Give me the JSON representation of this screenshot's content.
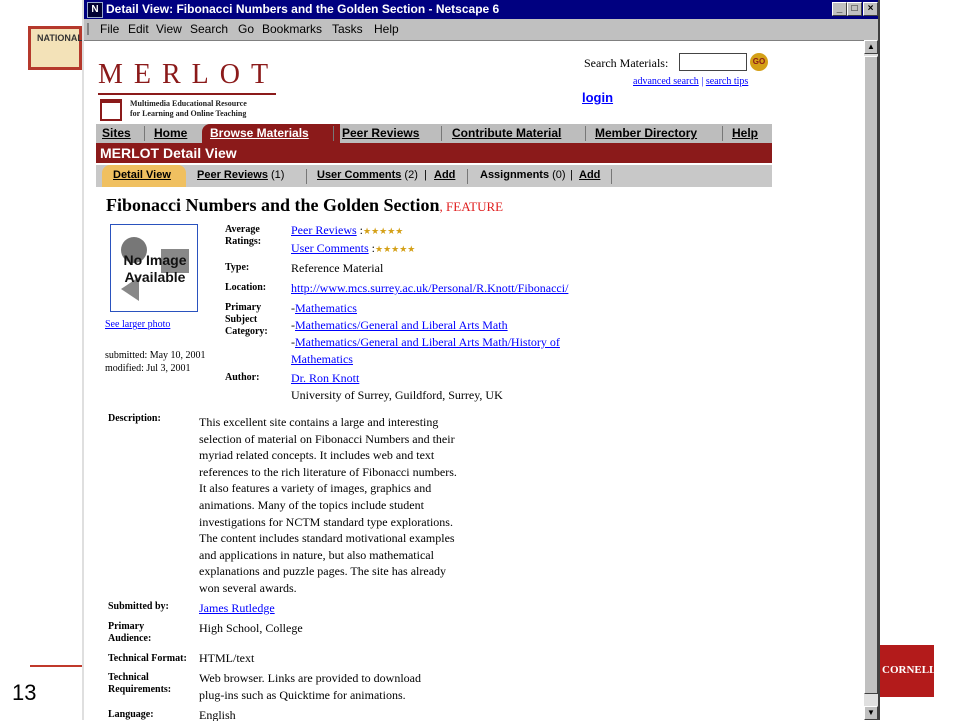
{
  "slide": {
    "logo_text": "NATIONAL",
    "slide_number": "13",
    "cornell_logo": "CORNELL"
  },
  "window": {
    "title": "Detail View: Fibonacci Numbers and the Golden Section - Netscape 6",
    "app_icon": "N",
    "menu": [
      "File",
      "Edit",
      "View",
      "Search",
      "Go",
      "Bookmarks",
      "Tasks",
      "Help"
    ]
  },
  "header": {
    "logo_word": "MERLOT",
    "logo_tagline_1": "Multimedia Educational Resource",
    "logo_tagline_2": "for Learning and Online Teaching",
    "search_label": "Search Materials:",
    "search_value": "",
    "go_label": "GO",
    "advanced_search": "advanced search",
    "separator": "|",
    "search_tips": "search tips",
    "login": "login"
  },
  "nav": {
    "items": [
      "Sites",
      "Home",
      "Browse Materials",
      "Peer Reviews",
      "Contribute Material",
      "Member Directory",
      "Help"
    ],
    "active": "Browse Materials"
  },
  "detail_bar": "MERLOT Detail View",
  "subtabs": {
    "detail_view": "Detail View",
    "peer_reviews": "Peer Reviews",
    "peer_reviews_count": "(1)",
    "user_comments": "User Comments",
    "user_comments_count": "(2)",
    "add1": "Add",
    "assignments": "Assignments",
    "assignments_count": "(0)",
    "add2": "Add",
    "pipe": "|"
  },
  "material": {
    "title": "Fibonacci Numbers and the Golden Section",
    "feature": ", FEATURE",
    "no_image_1": "No Image",
    "no_image_2": "Available",
    "see_larger": "See larger photo",
    "submitted": "submitted: May 10, 2001",
    "modified": "modified: Jul 3, 2001",
    "labels": {
      "avg_ratings_1": "Average",
      "avg_ratings_2": "Ratings:",
      "type": "Type:",
      "location": "Location:",
      "primary_1": "Primary",
      "primary_2": "Subject",
      "primary_3": "Category:",
      "author": "Author:",
      "description": "Description:",
      "submitted_by": "Submitted by:",
      "audience_1": "Primary",
      "audience_2": "Audience:",
      "tech_format": "Technical Format:",
      "tech_req_1": "Technical",
      "tech_req_2": "Requirements:",
      "language": "Language:"
    },
    "peer_reviews_link": "Peer Reviews",
    "user_comments_link": "User Comments",
    "rating_stars": "★★★★★",
    "colon": ":",
    "type": "Reference Material",
    "location": "http://www.mcs.surrey.ac.uk/Personal/R.Knott/Fibonacci/",
    "category_dash": "-",
    "category_1": "Mathematics",
    "category_2": "Mathematics/General and Liberal Arts Math",
    "category_3a": "Mathematics/General and Liberal Arts Math/History of",
    "category_3b": "Mathematics",
    "author_name": "Dr. Ron Knott",
    "author_affil": "University of Surrey, Guildford, Surrey, UK",
    "description_lines": [
      "This excellent site contains a large and interesting",
      "selection of material on Fibonacci Numbers and their",
      "myriad related concepts. It includes web and text",
      "references to the rich literature of Fibonacci numbers.",
      "It also features a variety of images, graphics and",
      "animations. Many of the topics include student",
      "investigations for NCTM standard type explorations.",
      "The content includes standard motivational examples",
      "and applications in nature, but also mathematical",
      "explanations and puzzle pages. The site has already",
      "won several awards."
    ],
    "submitted_by": "James Rutledge",
    "audience": "High School, College",
    "tech_format": "HTML/text",
    "tech_req_1": "Web browser. Links are provided to download",
    "tech_req_2": "plug-ins such as Quicktime for animations.",
    "language": "English"
  }
}
